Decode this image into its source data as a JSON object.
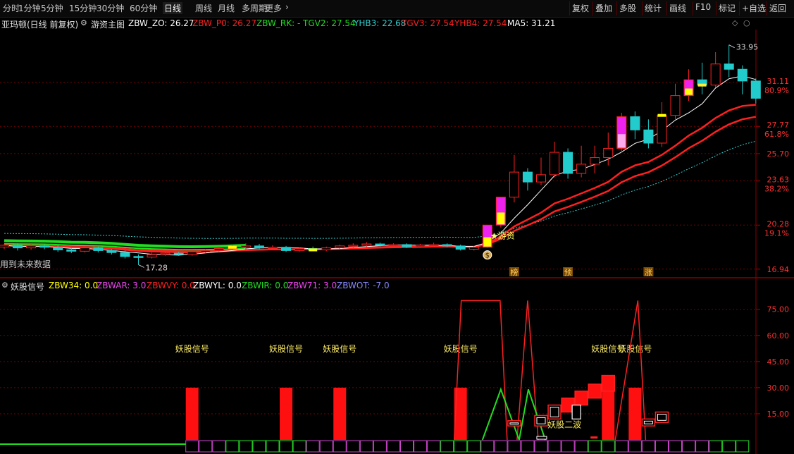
{
  "toolbar": {
    "tabs": [
      "分时",
      "1分钟",
      "5分钟",
      "15分钟",
      "30分钟",
      "60分钟",
      "日线",
      "周线",
      "月线",
      "多周期",
      "更多"
    ],
    "active_tab": "日线",
    "right_buttons": [
      "复权",
      "叠加",
      "多股",
      "统计",
      "画线",
      "F10",
      "标记",
      "+自选",
      "返回"
    ]
  },
  "main_panel": {
    "stock_name": "亚玛顿(日线 前复权)",
    "indicator_name": "游资主图",
    "legend": [
      {
        "label": "ZBW_ZO: 26.27",
        "color": "#ffffff"
      },
      {
        "label": "ZBW_P0: 26.27",
        "color": "#ff2020"
      },
      {
        "label": "ZBW_RK: -",
        "color": "#22dd22"
      },
      {
        "label": "TGV2: 27.54",
        "color": "#22dd22"
      },
      {
        "label": "YHB3: 22.68",
        "color": "#33cccc"
      },
      {
        "label": "TGV3: 27.54",
        "color": "#ff2020"
      },
      {
        "label": "YHB4: 27.54",
        "color": "#ff2020"
      },
      {
        "label": "MA5: 31.21",
        "color": "#ffffff"
      }
    ],
    "high_label": "33.95",
    "low_label": "17.28",
    "left_note": "用到未来数据",
    "signal_text": "★游资",
    "coin_symbol": "$",
    "markers": [
      "榜",
      "预",
      "涨"
    ]
  },
  "indicator_panel": {
    "name": "妖股信号",
    "legend": [
      {
        "label": "ZBW34: 0.0",
        "color": "#ffff00"
      },
      {
        "label": "ZBWAR: 3.0",
        "color": "#ee44ee"
      },
      {
        "label": "ZBWVY: 0.0",
        "color": "#ff2020"
      },
      {
        "label": "ZBWYL: 0.0",
        "color": "#ffffff"
      },
      {
        "label": "ZBWIR: 0.0",
        "color": "#22dd22"
      },
      {
        "label": "ZBW71: 3.0",
        "color": "#ee44ee"
      },
      {
        "label": "ZBWOT: -7.0",
        "color": "#8888ff"
      }
    ],
    "signal_label": "妖股信号",
    "second_wave_label": "妖股二波"
  },
  "chart_data": [
    {
      "type": "candlestick",
      "title": "",
      "y_ticks": [
        {
          "value": 31.11,
          "pct": "80.9%"
        },
        {
          "value": 27.77,
          "pct": "61.8%"
        },
        {
          "value": 25.7,
          "pct": ""
        },
        {
          "value": 23.63,
          "pct": "38.2%"
        },
        {
          "value": 20.28,
          "pct": "19.1%"
        },
        {
          "value": 16.94,
          "pct": ""
        }
      ],
      "ylim": [
        16.5,
        35
      ],
      "candles": [
        [
          18.62,
          18.75,
          18.45,
          18.85
        ],
        [
          18.75,
          18.55,
          18.35,
          18.9
        ],
        [
          18.55,
          18.7,
          18.4,
          18.85
        ],
        [
          18.7,
          18.6,
          18.45,
          18.8
        ],
        [
          18.6,
          18.4,
          18.25,
          18.75
        ],
        [
          18.4,
          18.3,
          18.15,
          18.55
        ],
        [
          18.3,
          18.55,
          18.2,
          18.7
        ],
        [
          18.55,
          18.35,
          18.2,
          18.65
        ],
        [
          18.35,
          18.2,
          18.05,
          18.45
        ],
        [
          18.2,
          17.9,
          17.75,
          18.35
        ],
        [
          17.9,
          17.85,
          17.28,
          18.05
        ],
        [
          17.85,
          18.05,
          17.75,
          18.2
        ],
        [
          18.05,
          18.15,
          17.95,
          18.3
        ],
        [
          18.15,
          18.05,
          17.95,
          18.25
        ],
        [
          18.05,
          18.25,
          17.95,
          18.4
        ],
        [
          18.25,
          18.35,
          18.15,
          18.45
        ],
        [
          18.35,
          18.5,
          18.25,
          18.65
        ],
        [
          18.5,
          18.6,
          18.4,
          18.75
        ],
        [
          18.6,
          18.7,
          18.45,
          18.9
        ],
        [
          18.7,
          18.55,
          18.45,
          18.85
        ],
        [
          18.55,
          18.6,
          18.45,
          18.75
        ],
        [
          18.6,
          18.35,
          18.25,
          18.7
        ],
        [
          18.35,
          18.5,
          18.25,
          18.6
        ],
        [
          18.5,
          18.4,
          18.3,
          18.65
        ],
        [
          18.4,
          18.55,
          18.3,
          18.65
        ],
        [
          18.55,
          18.7,
          18.45,
          18.8
        ],
        [
          18.7,
          18.75,
          18.55,
          18.9
        ],
        [
          18.75,
          18.85,
          18.6,
          19.0
        ],
        [
          18.85,
          18.75,
          18.65,
          18.95
        ],
        [
          18.75,
          18.8,
          18.6,
          18.9
        ],
        [
          18.8,
          18.65,
          18.55,
          18.9
        ],
        [
          18.65,
          18.75,
          18.55,
          18.85
        ],
        [
          18.75,
          18.8,
          18.6,
          18.95
        ],
        [
          18.8,
          18.7,
          18.6,
          18.9
        ],
        [
          18.7,
          18.45,
          18.35,
          18.8
        ],
        [
          18.45,
          18.6,
          18.35,
          18.7
        ],
        [
          18.6,
          20.28,
          18.55,
          20.28
        ],
        [
          20.28,
          22.4,
          20.1,
          22.4
        ],
        [
          22.4,
          24.3,
          22.0,
          25.6
        ],
        [
          24.3,
          23.55,
          22.9,
          24.6
        ],
        [
          23.55,
          24.1,
          23.3,
          25.4
        ],
        [
          24.1,
          25.8,
          23.9,
          26.6
        ],
        [
          25.8,
          24.2,
          23.8,
          26.1
        ],
        [
          24.2,
          24.9,
          23.9,
          26.3
        ],
        [
          24.9,
          25.4,
          24.2,
          26.3
        ],
        [
          25.4,
          26.1,
          24.8,
          27.3
        ],
        [
          26.1,
          28.5,
          25.8,
          28.8
        ],
        [
          28.5,
          27.5,
          26.8,
          28.9
        ],
        [
          27.5,
          26.5,
          26.1,
          28.3
        ],
        [
          26.5,
          28.6,
          26.2,
          29.6
        ],
        [
          28.6,
          30.1,
          28.3,
          31.0
        ],
        [
          30.1,
          31.3,
          29.7,
          32.1
        ],
        [
          31.3,
          30.9,
          30.2,
          32.6
        ],
        [
          30.9,
          32.5,
          30.7,
          33.4
        ],
        [
          32.5,
          32.1,
          31.5,
          33.95
        ],
        [
          32.1,
          31.21,
          30.2,
          32.4
        ],
        [
          31.21,
          29.9,
          29.5,
          31.4
        ]
      ],
      "volume": [
        {
          "name": "ZBWAR",
          "values": [
            0,
            0,
            0,
            0,
            0,
            0,
            0,
            0,
            0,
            0,
            0,
            0,
            0,
            0,
            0,
            0,
            0,
            0,
            0,
            0,
            0,
            0,
            0,
            0,
            0,
            0,
            0,
            0,
            0,
            0,
            0,
            0,
            0,
            0,
            0,
            0,
            0,
            0,
            0,
            0,
            0,
            0,
            0,
            0,
            0,
            0,
            0,
            0,
            0,
            0,
            0,
            0,
            0,
            0,
            0,
            0,
            0
          ]
        },
        {
          "name": "ZBWAR",
          "values": [
            0,
            0,
            0,
            0,
            0,
            0,
            0,
            0,
            0,
            0,
            0,
            0,
            0,
            0,
            0,
            0,
            0,
            0,
            0,
            0,
            0,
            0,
            0,
            0,
            0,
            0,
            0,
            0,
            0,
            0,
            0,
            0,
            0,
            0,
            0,
            0,
            0,
            0,
            0,
            0,
            0,
            0,
            0,
            0,
            0,
            0,
            0,
            0,
            0,
            0,
            0,
            0,
            0,
            0,
            0,
            0,
            0
          ]
        }
      ]
    },
    {
      "type": "bar",
      "title": "",
      "y_ticks": [
        75.0,
        60.0,
        45.0,
        30.0,
        15.0
      ],
      "ylim": [
        0,
        85
      ],
      "signal_bars": [
        14,
        21,
        25,
        34,
        45,
        47
      ],
      "step_boxes": [
        {
          "x": 38,
          "bottom": 8,
          "top": 11
        },
        {
          "x": 40,
          "bottom": 8,
          "top": 14
        },
        {
          "x": 41,
          "bottom": 12,
          "top": 20
        },
        {
          "x": 42,
          "bottom": 16,
          "top": 24
        },
        {
          "x": 43,
          "bottom": 20,
          "top": 28
        },
        {
          "x": 44,
          "bottom": 24,
          "top": 32
        },
        {
          "x": 45,
          "bottom": 28,
          "top": 37
        },
        {
          "x": 48,
          "bottom": 8,
          "top": 12
        },
        {
          "x": 49,
          "bottom": 10,
          "top": 16
        }
      ]
    }
  ]
}
